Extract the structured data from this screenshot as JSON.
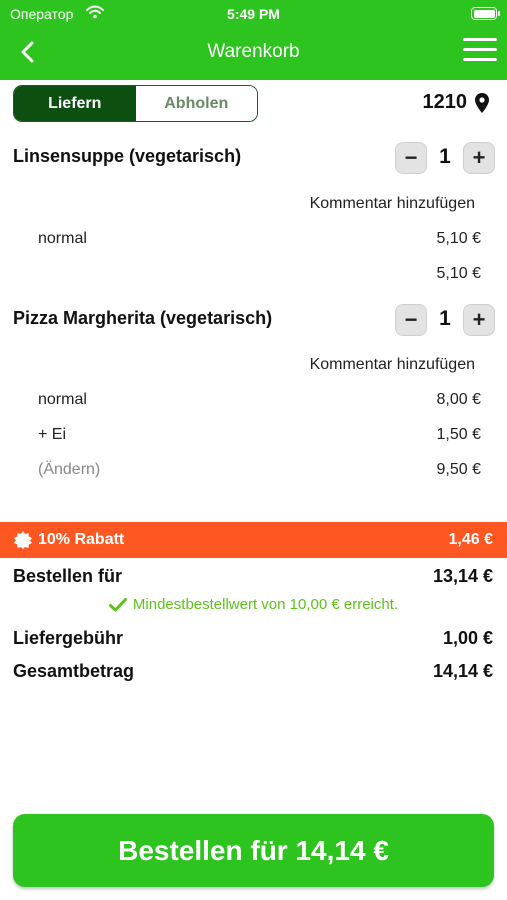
{
  "status_bar": {
    "carrier": "Оператор",
    "time": "5:49 PM"
  },
  "header": {
    "title": "Warenkorb"
  },
  "segmented": {
    "deliver": "Liefern",
    "pickup": "Abholen",
    "selected": "Liefern"
  },
  "location": {
    "postcode": "1210"
  },
  "items": [
    {
      "name": "Linsensuppe (vegetarisch)",
      "quantity": "1",
      "comment_label": "Kommentar hinzufügen",
      "options": [
        {
          "label": "normal",
          "price": "5,10 €"
        }
      ],
      "total": "5,10 €"
    },
    {
      "name": "Pizza Margherita (vegetarisch)",
      "quantity": "1",
      "comment_label": "Kommentar hinzufügen",
      "options": [
        {
          "label": "normal",
          "price": "8,00 €"
        },
        {
          "label": "+ Ei",
          "price": "1,50 €"
        }
      ],
      "change_label": "(Ändern)",
      "total": "9,50 €"
    }
  ],
  "discount": {
    "label": "10% Rabatt",
    "amount": "1,46 €",
    "color": "#ff5722"
  },
  "summary": {
    "order_for_label": "Bestellen für",
    "order_for_value": "13,14 €",
    "minimum_text": "Mindestbestellwert von 10,00 € erreicht.",
    "delivery_fee_label": "Liefergebühr",
    "delivery_fee_value": "1,00 €",
    "total_label": "Gesamtbetrag",
    "total_value": "14,14 €"
  },
  "order_button": {
    "label": "Bestellen für 14,14 €"
  },
  "colors": {
    "brand": "#2ec41f",
    "segment_active": "#0d4f10",
    "success": "#5cc21a"
  }
}
